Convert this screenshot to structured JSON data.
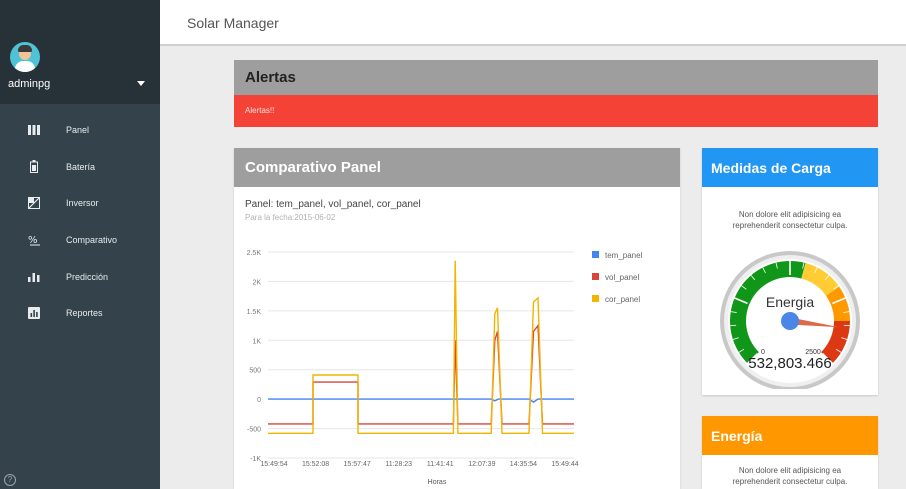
{
  "app": {
    "title": "Solar Manager"
  },
  "user": {
    "name": "adminpg"
  },
  "sidebar": {
    "items": [
      {
        "label": "Panel",
        "icon": "bars-icon"
      },
      {
        "label": "Batería",
        "icon": "battery-icon"
      },
      {
        "label": "Inversor",
        "icon": "inverter-icon"
      },
      {
        "label": "Comparativo",
        "icon": "compare-icon"
      },
      {
        "label": "Predicción",
        "icon": "chart-bars-icon"
      },
      {
        "label": "Reportes",
        "icon": "report-icon"
      }
    ]
  },
  "alerts": {
    "title": "Alertas",
    "message": "Alertas!!"
  },
  "panel_card": {
    "title": "Comparativo Panel",
    "subtitle": "Panel: tem_panel, vol_panel, cor_panel",
    "date_text": "Para la fecha:2015-06-02"
  },
  "chart_data": {
    "type": "line",
    "subtitle": "Panel: tem_panel, vol_panel, cor_panel",
    "xlabel": "Horas",
    "ylabel": "",
    "ylim": [
      -1000,
      2500
    ],
    "yticks": [
      "2.5K",
      "2K",
      "1.5K",
      "1K",
      "500",
      "0",
      "-500",
      "-1K"
    ],
    "x_tick_labels": [
      "15:49:54",
      "15:52:08",
      "15:57:47",
      "11:28:23",
      "11:41:41",
      "12:07:39",
      "14:35:54",
      "15:49:44"
    ],
    "legend_position": "right",
    "series": [
      {
        "name": "tem_panel",
        "color": "#4285f4",
        "points": [
          [
            0,
            0
          ],
          [
            50,
            0
          ],
          [
            92,
            0
          ],
          [
            200,
            0
          ],
          [
            206,
            0
          ],
          [
            208,
            0
          ],
          [
            211,
            0
          ],
          [
            248,
            0
          ],
          [
            252,
            -30
          ],
          [
            256,
            0
          ],
          [
            290,
            0
          ],
          [
            295,
            -50
          ],
          [
            300,
            0
          ],
          [
            340,
            0
          ]
        ]
      },
      {
        "name": "vol_panel",
        "color": "#d9453a",
        "points": [
          [
            0,
            -420
          ],
          [
            50,
            -420
          ],
          [
            50,
            290
          ],
          [
            100,
            290
          ],
          [
            100,
            -420
          ],
          [
            200,
            -420
          ],
          [
            206,
            -420
          ],
          [
            208,
            1000
          ],
          [
            211,
            -420
          ],
          [
            248,
            -420
          ],
          [
            252,
            1000
          ],
          [
            255,
            1150
          ],
          [
            260,
            -420
          ],
          [
            290,
            -420
          ],
          [
            295,
            1150
          ],
          [
            300,
            1250
          ],
          [
            305,
            -420
          ],
          [
            340,
            -420
          ]
        ]
      },
      {
        "name": "cor_panel",
        "color": "#f4b400",
        "points": [
          [
            0,
            -580
          ],
          [
            50,
            -580
          ],
          [
            50,
            410
          ],
          [
            100,
            410
          ],
          [
            100,
            -580
          ],
          [
            200,
            -580
          ],
          [
            206,
            -580
          ],
          [
            208,
            2350
          ],
          [
            211,
            -580
          ],
          [
            248,
            -580
          ],
          [
            252,
            1450
          ],
          [
            255,
            1550
          ],
          [
            260,
            -580
          ],
          [
            290,
            -580
          ],
          [
            295,
            1650
          ],
          [
            300,
            1720
          ],
          [
            305,
            -580
          ],
          [
            340,
            -580
          ]
        ]
      }
    ]
  },
  "medidas": {
    "title": "Medidas de Carga",
    "text": "Non dolore elit adipisicing ea reprehenderit consectetur culpa.",
    "gauge": {
      "label": "Energia",
      "min_label": "0",
      "max_label": "2500",
      "value_label": "532,803.466",
      "needle_fraction": 0.86
    }
  },
  "energia": {
    "title": "Energía",
    "text": "Non dolore elit adipisicing ea reprehenderit consectetur culpa."
  },
  "colors": {
    "sidebar": "#34434b",
    "alert": "#f44336",
    "medidas": "#2196f3",
    "energia": "#ff9800"
  }
}
